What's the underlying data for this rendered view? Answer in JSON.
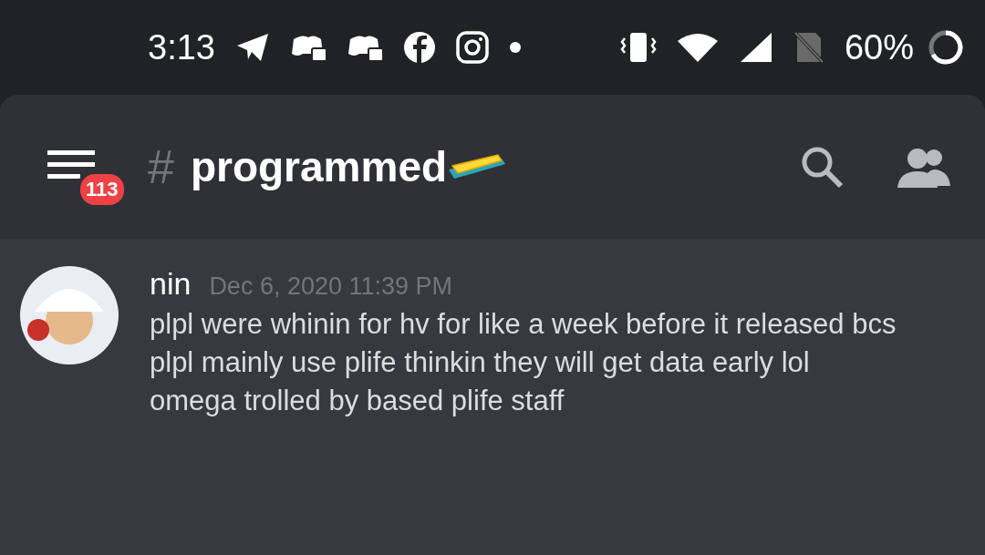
{
  "status_bar": {
    "time": "3:13",
    "battery": "60%"
  },
  "header": {
    "badge": "113",
    "hash": "#",
    "channel": "programmed"
  },
  "messages": [
    {
      "author": "nin",
      "timestamp": "Dec 6, 2020 11:39 PM",
      "lines": [
        "plpl were whinin for hv for like a week before it released bcs plpl mainly use plife thinkin they will get data early lol",
        "omega trolled by based plife staff"
      ]
    }
  ]
}
